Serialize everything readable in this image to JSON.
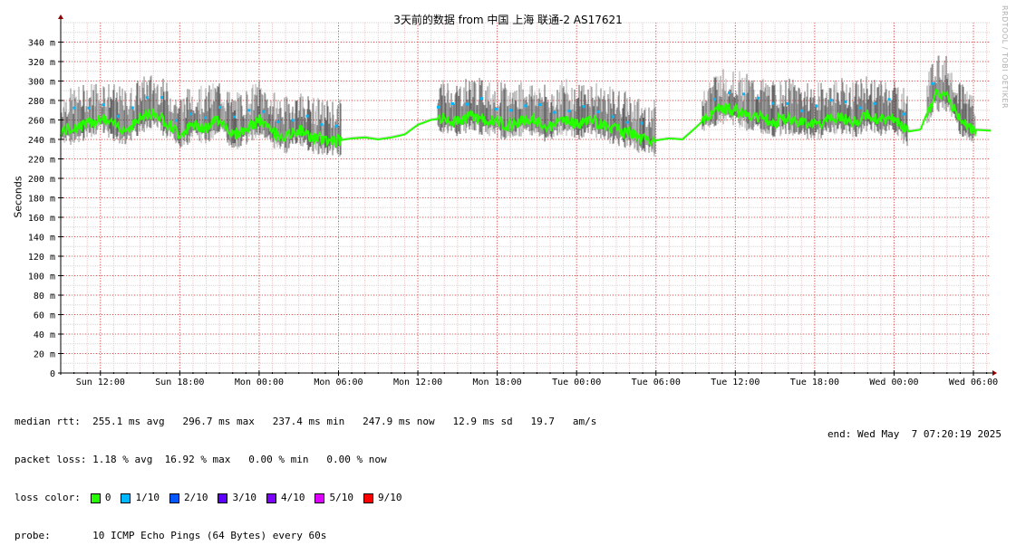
{
  "title": "3天前的数据 from 中国 上海 联通-2 AS17621",
  "watermark": "RRDTOOL / TOBI OETIKER",
  "chart_data": {
    "type": "area",
    "title": "3天前的数据 from 中国 上海 联通-2 AS17621",
    "ylabel": "Seconds",
    "ylim": [
      0,
      0.36
    ],
    "yticks": [
      {
        "v": 0,
        "label": "0"
      },
      {
        "v": 0.02,
        "label": "20 m"
      },
      {
        "v": 0.04,
        "label": "40 m"
      },
      {
        "v": 0.06,
        "label": "60 m"
      },
      {
        "v": 0.08,
        "label": "80 m"
      },
      {
        "v": 0.1,
        "label": "100 m"
      },
      {
        "v": 0.12,
        "label": "120 m"
      },
      {
        "v": 0.14,
        "label": "140 m"
      },
      {
        "v": 0.16,
        "label": "160 m"
      },
      {
        "v": 0.18,
        "label": "180 m"
      },
      {
        "v": 0.2,
        "label": "200 m"
      },
      {
        "v": 0.22,
        "label": "220 m"
      },
      {
        "v": 0.24,
        "label": "240 m"
      },
      {
        "v": 0.26,
        "label": "260 m"
      },
      {
        "v": 0.28,
        "label": "280 m"
      },
      {
        "v": 0.3,
        "label": "300 m"
      },
      {
        "v": 0.32,
        "label": "320 m"
      },
      {
        "v": 0.34,
        "label": "340 m"
      }
    ],
    "xticks": [
      "Sun 12:00",
      "Sun 18:00",
      "Mon 00:00",
      "Mon 06:00",
      "Mon 12:00",
      "Mon 18:00",
      "Tue 00:00",
      "Tue 06:00",
      "Tue 12:00",
      "Tue 18:00",
      "Wed 00:00",
      "Wed 06:00"
    ],
    "x_hours_range": [
      -3.0,
      67.3
    ],
    "grid": true,
    "median_series": [
      [
        -3.0,
        0.248
      ],
      [
        -2.0,
        0.252
      ],
      [
        -1.0,
        0.256
      ],
      [
        0.0,
        0.262
      ],
      [
        1.0,
        0.255
      ],
      [
        2.0,
        0.25
      ],
      [
        3.0,
        0.262
      ],
      [
        4.0,
        0.268
      ],
      [
        5.0,
        0.258
      ],
      [
        6.0,
        0.245
      ],
      [
        7.0,
        0.255
      ],
      [
        8.0,
        0.252
      ],
      [
        9.0,
        0.262
      ],
      [
        10.0,
        0.245
      ],
      [
        11.0,
        0.25
      ],
      [
        12.0,
        0.26
      ],
      [
        13.0,
        0.248
      ],
      [
        14.0,
        0.242
      ],
      [
        15.0,
        0.25
      ],
      [
        16.0,
        0.242
      ],
      [
        17.0,
        0.24
      ],
      [
        18.0,
        0.239
      ],
      [
        19.0,
        0.241
      ],
      [
        20.0,
        0.242
      ],
      [
        21.0,
        0.24
      ],
      [
        22.0,
        0.242
      ],
      [
        23.0,
        0.245
      ],
      [
        24.0,
        0.255
      ],
      [
        25.0,
        0.26
      ],
      [
        26.0,
        0.262
      ],
      [
        27.0,
        0.258
      ],
      [
        28.0,
        0.265
      ],
      [
        29.0,
        0.26
      ],
      [
        30.0,
        0.258
      ],
      [
        31.0,
        0.255
      ],
      [
        32.0,
        0.26
      ],
      [
        33.0,
        0.258
      ],
      [
        34.0,
        0.252
      ],
      [
        35.0,
        0.262
      ],
      [
        36.0,
        0.255
      ],
      [
        37.0,
        0.26
      ],
      [
        38.0,
        0.255
      ],
      [
        39.0,
        0.25
      ],
      [
        40.0,
        0.247
      ],
      [
        41.0,
        0.24
      ],
      [
        42.0,
        0.239
      ],
      [
        43.0,
        0.241
      ],
      [
        44.0,
        0.24
      ],
      [
        45.0,
        0.252
      ],
      [
        46.0,
        0.265
      ],
      [
        47.0,
        0.272
      ],
      [
        48.0,
        0.27
      ],
      [
        49.0,
        0.265
      ],
      [
        50.0,
        0.262
      ],
      [
        51.0,
        0.258
      ],
      [
        52.0,
        0.262
      ],
      [
        53.0,
        0.258
      ],
      [
        54.0,
        0.255
      ],
      [
        55.0,
        0.26
      ],
      [
        56.0,
        0.262
      ],
      [
        57.0,
        0.258
      ],
      [
        58.0,
        0.265
      ],
      [
        59.0,
        0.26
      ],
      [
        60.0,
        0.262
      ],
      [
        61.0,
        0.248
      ],
      [
        62.0,
        0.25
      ],
      [
        63.0,
        0.285
      ],
      [
        64.0,
        0.285
      ],
      [
        65.0,
        0.26
      ],
      [
        66.0,
        0.25
      ],
      [
        67.3,
        0.249
      ]
    ],
    "stats": {
      "median_rtt": "255.1 ms avg   296.7 ms max   237.4 ms min   247.9 ms now   12.9 ms sd   19.7   am/s",
      "packet_loss": "1.18 % avg  16.92 % max   0.00 % min   0.00 % now"
    }
  },
  "legend": {
    "median_label": "median rtt:",
    "median_text": "  255.1 ms avg   296.7 ms max   237.4 ms min   247.9 ms now   12.9 ms sd   19.7   am/s",
    "loss_label": "packet loss:",
    "loss_text": " 1.18 % avg  16.92 % max   0.00 % min   0.00 % now",
    "color_label": "loss color:",
    "loss_colors": [
      {
        "label": "0",
        "color": "#26ff00"
      },
      {
        "label": "1/10",
        "color": "#00b8ff"
      },
      {
        "label": "2/10",
        "color": "#0059ff"
      },
      {
        "label": "3/10",
        "color": "#5e00ff"
      },
      {
        "label": "4/10",
        "color": "#7e00ff"
      },
      {
        "label": "5/10",
        "color": "#dd00ff"
      },
      {
        "label": "9/10",
        "color": "#ff0000"
      }
    ],
    "probe_label": "probe:",
    "probe_text": "       10 ICMP Echo Pings (64 Bytes) every 60s",
    "end_text": "end: Wed May  7 07:20:19 2025"
  }
}
